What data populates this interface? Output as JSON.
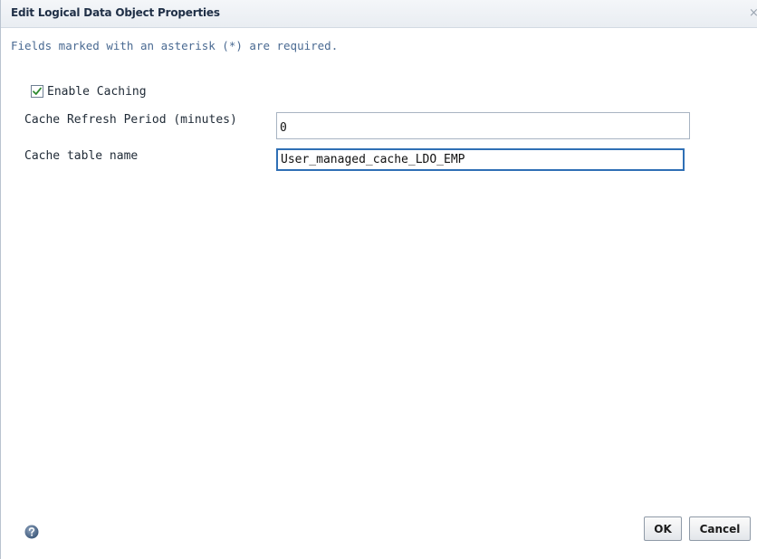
{
  "dialog": {
    "title": "Edit Logical Data Object Properties",
    "close_glyph": "×",
    "required_note": "Fields marked with an asterisk (*) are required."
  },
  "form": {
    "enable_caching": {
      "label": "Enable Caching",
      "checked": true
    },
    "cache_refresh_period": {
      "label": "Cache Refresh Period (minutes)",
      "value": "0"
    },
    "cache_table_name": {
      "label": "Cache table name",
      "value": "User_managed_cache_LDO_EMP"
    }
  },
  "footer": {
    "help_icon": "question-circle-icon",
    "ok_label": "OK",
    "cancel_label": "Cancel"
  },
  "colors": {
    "accent": "#2f6fb5",
    "check": "#2f8a2f",
    "note_text": "#4a6a92"
  }
}
